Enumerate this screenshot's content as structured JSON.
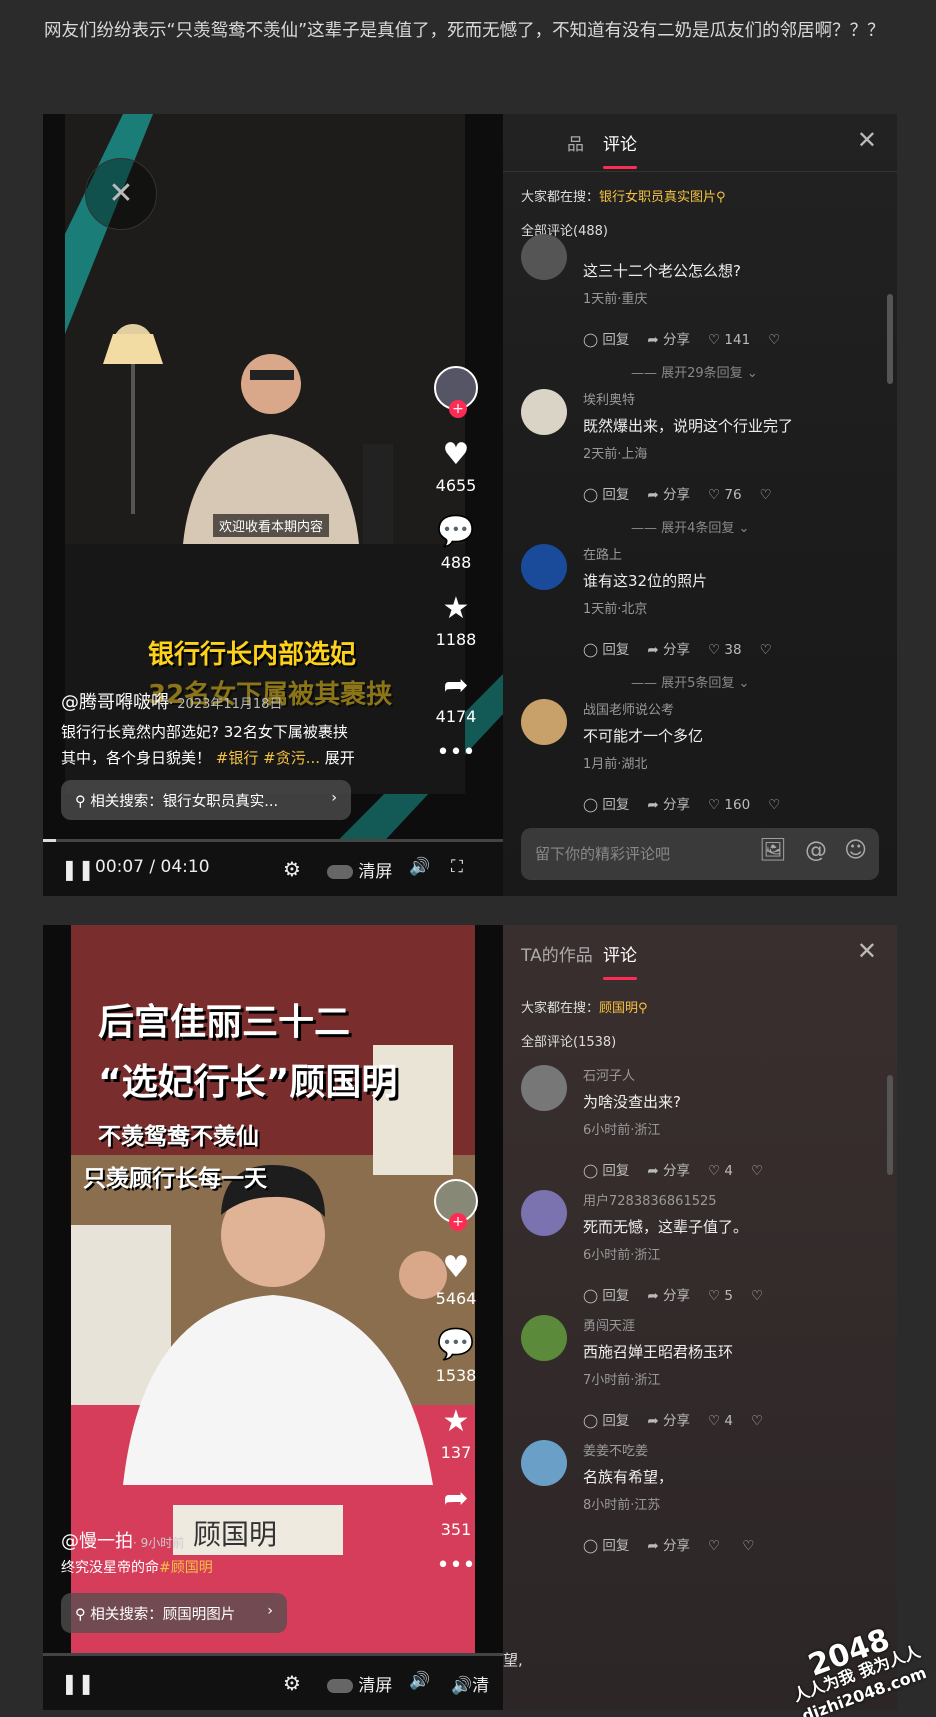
{
  "intro": "网友们纷纷表示“只羡鸳鸯不羡仙”这辈子是真值了，死而无憾了，不知道有没有二奶是瓜友们的邻居啊？？？",
  "panel1": {
    "tabs": [
      "品",
      "评论"
    ],
    "hot_prefix": "大家都在搜：",
    "hot_keyword": "银行女职员真实图片",
    "total": "全部评论(488)",
    "comments": [
      {
        "nick": "",
        "text": "这三十二个老公怎么想?",
        "meta": "1天前·重庆",
        "likes": "141",
        "more": "展开29条回复"
      },
      {
        "nick": "埃利奥特",
        "text": "既然爆出来，说明这个行业完了",
        "meta": "2天前·上海",
        "likes": "76",
        "more": "展开4条回复"
      },
      {
        "nick": "在路上",
        "text": "谁有这32位的照片",
        "meta": "1天前·北京",
        "likes": "38",
        "more": "展开5条回复"
      },
      {
        "nick": "战国老师说公考",
        "text": "不可能才一个多亿",
        "meta": "1月前·湖北",
        "likes": "160",
        "more": ""
      }
    ],
    "reply": "回复",
    "share": "分享",
    "input_placeholder": "留下你的精彩评论吧",
    "video": {
      "subtitle": "欢迎收看本期内容",
      "overlay_line1": "银行行长内部选妃",
      "overlay_line2": "32名女下属被其裹挟",
      "author": "@腾哥嘚啵嘚",
      "date": "· 2023年11月18日",
      "desc_line1": "银行行长竟然内部选妃? 32名女下属被裹挟",
      "desc_line2": "其中，各个身日貌美！",
      "tags": "#银行 #贪污...",
      "expand": "展开",
      "related": "相关搜索：银行女职员真实...",
      "rail": {
        "likes": "4655",
        "comments": "488",
        "favorites": "1188",
        "shares": "4174"
      },
      "time": "00:07 / 04:10",
      "clear": "清屏",
      "progress": 0.028
    }
  },
  "panel2": {
    "tabs": [
      "TA的作品",
      "评论"
    ],
    "hot_prefix": "大家都在搜：",
    "hot_keyword": "顾国明",
    "total": "全部评论(1538)",
    "comments": [
      {
        "nick": "石河子人",
        "text": "为啥没查出来?",
        "meta": "6小时前·浙江",
        "likes": "4"
      },
      {
        "nick": "用户7283836861525",
        "text": "死而无憾，这辈子值了。",
        "meta": "6小时前·浙江",
        "likes": "5"
      },
      {
        "nick": "勇闯天涯",
        "text": "西施召婵王昭君杨玉环",
        "meta": "7小时前·浙江",
        "likes": "4"
      },
      {
        "nick": "姜姜不吃姜",
        "text": "名族有希望，",
        "meta": "8小时前·江苏",
        "likes": ""
      }
    ],
    "reply": "回复",
    "share": "分享",
    "video": {
      "title_line1": "后宫佳丽三十二",
      "title_line2": "“选妃行长”顾国明",
      "sub_line1": "不羡鸳鸯不羡仙",
      "sub_line2": "只羡顾行长每一天",
      "nameplate": "顾国明",
      "author": "@慢一拍",
      "date": "· 9小时前",
      "desc": "终究没星帝的命",
      "tag": "#顾国明",
      "related": "相关搜索：顾国明图片",
      "rail": {
        "likes": "5464",
        "comments": "1538",
        "favorites": "137",
        "shares": "351"
      },
      "clear": "清屏",
      "clear2": "清",
      "bottom_text": "望,"
    }
  },
  "watermark": {
    "line1": "2048",
    "line2": "人人为我 我为人人",
    "line3": "dizhi2048.com"
  },
  "colors": {
    "accent": "#fe2c55",
    "keyword": "#f5c242",
    "panel_bg": "#141414"
  }
}
